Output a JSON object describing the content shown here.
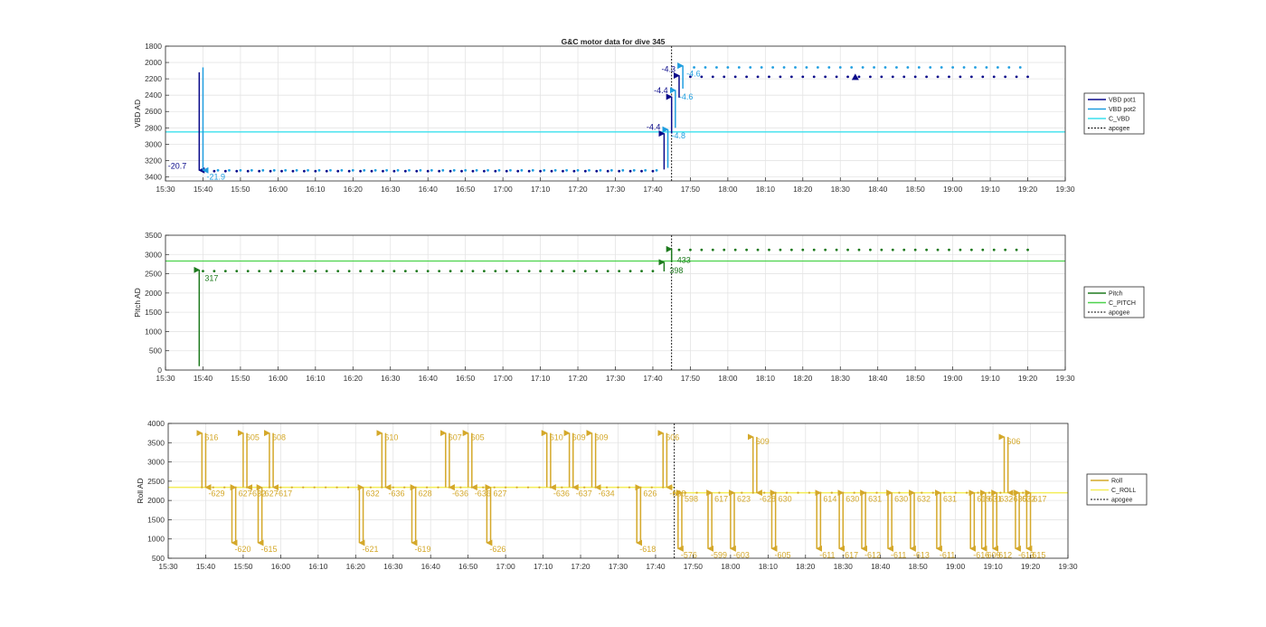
{
  "title": "G&C motor data for dive 345",
  "time_ticks": [
    "15:30",
    "15:40",
    "15:50",
    "16:00",
    "16:10",
    "16:20",
    "16:30",
    "16:40",
    "16:50",
    "17:00",
    "17:10",
    "17:20",
    "17:30",
    "17:40",
    "17:50",
    "18:00",
    "18:10",
    "18:20",
    "18:30",
    "18:40",
    "18:50",
    "19:00",
    "19:10",
    "19:20",
    "19:30"
  ],
  "colors": {
    "vbd_pot1": "#0a0a8a",
    "vbd_pot2": "#1f9ee0",
    "c_vbd": "#3ce0ee",
    "pitch": "#1e7a1e",
    "c_pitch": "#4cd24c",
    "roll": "#d4a82a",
    "c_roll": "#f4ee58",
    "apogee": "#000000",
    "grid": "#e4e4e4",
    "axis": "#262626"
  },
  "chart_data": [
    {
      "type": "scatter",
      "title": "G&C motor data for dive 345",
      "ylabel": "VBD AD",
      "xlim": [
        "15:30",
        "19:30"
      ],
      "ylim": [
        1800,
        3450
      ],
      "y_reversed": true,
      "y_ticks": [
        1800,
        2000,
        2200,
        2400,
        2600,
        2800,
        3000,
        3200,
        3400
      ],
      "grid": true,
      "legend_position": "right",
      "legend": [
        "VBD pot1",
        "VBD pot2",
        "C_VBD",
        "apogee"
      ],
      "apogee_time": "17:45",
      "commanded_value": 2850,
      "moves": [
        {
          "t": "15:39",
          "from": 2120,
          "to": 3320,
          "series": "VBD pot1",
          "label": "-20.7"
        },
        {
          "t": "15:40",
          "from": 2060,
          "to": 3320,
          "series": "VBD pot2",
          "label": "-21.9"
        },
        {
          "t": "17:43",
          "from": 3310,
          "to": 2870,
          "series": "VBD pot1",
          "label": "-4.4"
        },
        {
          "t": "17:44",
          "from": 3290,
          "to": 2820,
          "series": "VBD pot2",
          "label": "-4.8"
        },
        {
          "t": "17:45",
          "from": 2870,
          "to": 2420,
          "series": "VBD pot1",
          "label": "-4.4"
        },
        {
          "t": "17:46",
          "from": 2800,
          "to": 2340,
          "series": "VBD pot2",
          "label": "-4.6"
        },
        {
          "t": "17:47",
          "from": 2430,
          "to": 2160,
          "series": "VBD pot1",
          "label": "-4.3"
        },
        {
          "t": "17:48",
          "from": 2320,
          "to": 2040,
          "series": "VBD pot2",
          "label": "-4.6"
        },
        {
          "t": "18:34",
          "from": 2180,
          "to": 2180,
          "series": "VBD pot1",
          "label": ""
        }
      ],
      "series": [
        {
          "name": "VBD pot1",
          "segments": [
            {
              "from": "15:40",
              "to": "17:42",
              "step_min": 3,
              "value": 3330
            },
            {
              "from": "17:50",
              "to": "19:20",
              "step_min": 3,
              "value": 2175
            }
          ]
        },
        {
          "name": "VBD pot2",
          "segments": [
            {
              "from": "15:41",
              "to": "17:42",
              "step_min": 3,
              "value": 3320
            },
            {
              "from": "17:51",
              "to": "19:20",
              "step_min": 3,
              "value": 2060
            }
          ]
        }
      ]
    },
    {
      "type": "scatter",
      "ylabel": "Pitch AD",
      "xlim": [
        "15:30",
        "19:30"
      ],
      "ylim": [
        0,
        3500
      ],
      "y_ticks": [
        0,
        500,
        1000,
        1500,
        2000,
        2500,
        3000,
        3500
      ],
      "grid": true,
      "legend_position": "right",
      "legend": [
        "Pitch",
        "C_PITCH",
        "apogee"
      ],
      "apogee_time": "17:45",
      "commanded_value": 2830,
      "moves": [
        {
          "t": "15:39",
          "from": 100,
          "to": 2600,
          "series": "Pitch",
          "label": "317"
        },
        {
          "t": "17:43",
          "from": 2560,
          "to": 2800,
          "series": "Pitch",
          "label": "398"
        },
        {
          "t": "17:45",
          "from": 2800,
          "to": 3140,
          "series": "Pitch",
          "label": "433"
        }
      ],
      "series": [
        {
          "name": "Pitch",
          "segments": [
            {
              "from": "15:40",
              "to": "17:42",
              "step_min": 3,
              "value": 2570
            },
            {
              "from": "17:47",
              "to": "19:20",
              "step_min": 3,
              "value": 3120
            }
          ]
        }
      ]
    },
    {
      "type": "scatter",
      "ylabel": "Roll AD",
      "xlim": [
        "15:30",
        "19:30"
      ],
      "ylim": [
        500,
        4000
      ],
      "y_ticks": [
        500,
        1000,
        1500,
        2000,
        2500,
        3000,
        3500,
        4000
      ],
      "grid": true,
      "legend_position": "right",
      "legend": [
        "Roll",
        "C_ROLL",
        "apogee"
      ],
      "apogee_time": "17:45",
      "commanded_value_before": 2340,
      "commanded_value_after": 2200,
      "baseline_before": 2340,
      "baseline_after": 2200,
      "moves": [
        {
          "t": "15:39",
          "from": 2340,
          "to": 3750,
          "label": "616"
        },
        {
          "t": "15:40",
          "from": 3750,
          "to": 2340,
          "label": "-629"
        },
        {
          "t": "15:47",
          "from": 2340,
          "to": 900,
          "label": "-620"
        },
        {
          "t": "15:48",
          "from": 900,
          "to": 2340,
          "label": "627"
        },
        {
          "t": "15:50",
          "from": 2340,
          "to": 3750,
          "label": "605"
        },
        {
          "t": "15:51",
          "from": 3750,
          "to": 2340,
          "label": "-632"
        },
        {
          "t": "15:54",
          "from": 2340,
          "to": 900,
          "label": "-615"
        },
        {
          "t": "15:55",
          "from": 900,
          "to": 2340,
          "label": "627"
        },
        {
          "t": "15:57",
          "from": 2340,
          "to": 3750,
          "label": "608"
        },
        {
          "t": "15:58",
          "from": 3750,
          "to": 2340,
          "label": "-617"
        },
        {
          "t": "16:21",
          "from": 2340,
          "to": 900,
          "label": "-621"
        },
        {
          "t": "16:22",
          "from": 900,
          "to": 2340,
          "label": "632"
        },
        {
          "t": "16:27",
          "from": 2340,
          "to": 3750,
          "label": "610"
        },
        {
          "t": "16:28",
          "from": 3750,
          "to": 2340,
          "label": "-636"
        },
        {
          "t": "16:35",
          "from": 2340,
          "to": 900,
          "label": "-619"
        },
        {
          "t": "16:36",
          "from": 900,
          "to": 2340,
          "label": "628"
        },
        {
          "t": "16:44",
          "from": 2340,
          "to": 3750,
          "label": "607"
        },
        {
          "t": "16:45",
          "from": 3750,
          "to": 2340,
          "label": "-636"
        },
        {
          "t": "16:50",
          "from": 2340,
          "to": 3750,
          "label": "605"
        },
        {
          "t": "16:51",
          "from": 3750,
          "to": 2340,
          "label": "-636"
        },
        {
          "t": "16:55",
          "from": 2340,
          "to": 900,
          "label": "-626"
        },
        {
          "t": "16:56",
          "from": 900,
          "to": 2340,
          "label": "627"
        },
        {
          "t": "17:11",
          "from": 2340,
          "to": 3750,
          "label": "610"
        },
        {
          "t": "17:12",
          "from": 3750,
          "to": 2340,
          "label": "-636"
        },
        {
          "t": "17:17",
          "from": 2340,
          "to": 3750,
          "label": "609"
        },
        {
          "t": "17:18",
          "from": 3750,
          "to": 2340,
          "label": "-637"
        },
        {
          "t": "17:23",
          "from": 2340,
          "to": 3750,
          "label": "609"
        },
        {
          "t": "17:24",
          "from": 3750,
          "to": 2340,
          "label": "-634"
        },
        {
          "t": "17:35",
          "from": 2340,
          "to": 900,
          "label": "-618"
        },
        {
          "t": "17:36",
          "from": 900,
          "to": 2340,
          "label": "626"
        },
        {
          "t": "17:42",
          "from": 2340,
          "to": 3750,
          "label": "606"
        },
        {
          "t": "17:43",
          "from": 3750,
          "to": 2340,
          "label": "-638"
        },
        {
          "t": "17:46",
          "from": 2200,
          "to": 750,
          "label": "-576"
        },
        {
          "t": "17:47",
          "from": 750,
          "to": 2200,
          "label": "598"
        },
        {
          "t": "17:54",
          "from": 2200,
          "to": 750,
          "label": "-599"
        },
        {
          "t": "17:55",
          "from": 750,
          "to": 2200,
          "label": "617"
        },
        {
          "t": "18:00",
          "from": 2200,
          "to": 750,
          "label": "-603"
        },
        {
          "t": "18:01",
          "from": 750,
          "to": 2200,
          "label": "623"
        },
        {
          "t": "18:06",
          "from": 2200,
          "to": 3650,
          "label": "609"
        },
        {
          "t": "18:07",
          "from": 3650,
          "to": 2200,
          "label": "-628"
        },
        {
          "t": "18:11",
          "from": 2200,
          "to": 750,
          "label": "-605"
        },
        {
          "t": "18:12",
          "from": 750,
          "to": 2200,
          "label": "630"
        },
        {
          "t": "18:23",
          "from": 2200,
          "to": 750,
          "label": "-611"
        },
        {
          "t": "18:24",
          "from": 750,
          "to": 2200,
          "label": "614"
        },
        {
          "t": "18:29",
          "from": 2200,
          "to": 750,
          "label": "-617"
        },
        {
          "t": "18:30",
          "from": 750,
          "to": 2200,
          "label": "630"
        },
        {
          "t": "18:35",
          "from": 2200,
          "to": 750,
          "label": "-612"
        },
        {
          "t": "18:36",
          "from": 750,
          "to": 2200,
          "label": "631"
        },
        {
          "t": "18:42",
          "from": 2200,
          "to": 750,
          "label": "-611"
        },
        {
          "t": "18:43",
          "from": 750,
          "to": 2200,
          "label": "630"
        },
        {
          "t": "18:48",
          "from": 2200,
          "to": 750,
          "label": "-613"
        },
        {
          "t": "18:49",
          "from": 750,
          "to": 2200,
          "label": "632"
        },
        {
          "t": "18:55",
          "from": 2200,
          "to": 750,
          "label": "-611"
        },
        {
          "t": "18:56",
          "from": 750,
          "to": 2200,
          "label": "631"
        },
        {
          "t": "19:04",
          "from": 2200,
          "to": 750,
          "label": "-616"
        },
        {
          "t": "19:05",
          "from": 750,
          "to": 2200,
          "label": "619"
        },
        {
          "t": "19:07",
          "from": 2200,
          "to": 750,
          "label": "-609"
        },
        {
          "t": "19:08",
          "from": 750,
          "to": 2200,
          "label": "631"
        },
        {
          "t": "19:10",
          "from": 2200,
          "to": 750,
          "label": "-612"
        },
        {
          "t": "19:11",
          "from": 750,
          "to": 2200,
          "label": "632"
        },
        {
          "t": "19:13",
          "from": 2200,
          "to": 3650,
          "label": "606"
        },
        {
          "t": "19:14",
          "from": 3650,
          "to": 2200,
          "label": "-635"
        },
        {
          "t": "19:16",
          "from": 2200,
          "to": 750,
          "label": "-613"
        },
        {
          "t": "19:17",
          "from": 750,
          "to": 2200,
          "label": "632"
        },
        {
          "t": "19:19",
          "from": 2200,
          "to": 750,
          "label": "-615"
        },
        {
          "t": "19:20",
          "from": 750,
          "to": 2200,
          "label": "617"
        }
      ]
    }
  ]
}
